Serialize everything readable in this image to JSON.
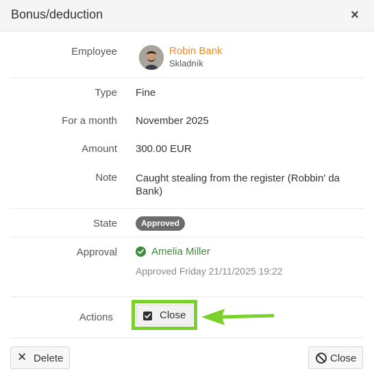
{
  "dialog": {
    "title": "Bonus/deduction",
    "close_glyph": "×"
  },
  "fields": {
    "employee": {
      "label": "Employee",
      "name": "Robin Bank",
      "role": "Skladník",
      "name_color": "#f08a24"
    },
    "type": {
      "label": "Type",
      "value": "Fine"
    },
    "month": {
      "label": "For a month",
      "value": "November 2025"
    },
    "amount": {
      "label": "Amount",
      "value": "300.00 EUR"
    },
    "note": {
      "label": "Note",
      "value": "Caught stealing from the register (Robbin' da Bank)"
    },
    "state": {
      "label": "State",
      "value": "Approved"
    },
    "approval": {
      "label": "Approval",
      "approver": "Amelia Miller",
      "info": "Approved Friday 21/11/2025 19:22",
      "icon": "check-circle-icon",
      "color": "#3f8a3a"
    },
    "actions": {
      "label": "Actions",
      "button": "Close",
      "highlight_color": "#7bd12b"
    }
  },
  "footer": {
    "delete_label": "Delete",
    "delete_icon": "times-icon",
    "close_label": "Close",
    "close_icon": "ban-icon"
  }
}
